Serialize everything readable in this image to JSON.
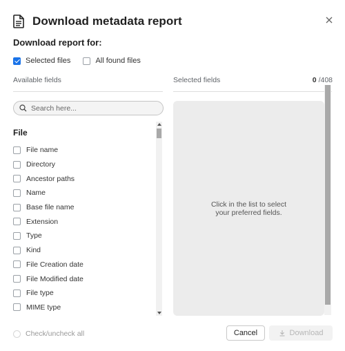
{
  "dialog": {
    "title": "Download metadata report",
    "close_icon": "close-icon",
    "title_icon": "document-icon"
  },
  "scope": {
    "heading": "Download report for:",
    "options": [
      {
        "label": "Selected files",
        "checked": true
      },
      {
        "label": "All found files",
        "checked": false
      }
    ]
  },
  "available": {
    "label": "Available fields",
    "search_placeholder": "Search here...",
    "group_title": "File",
    "fields": [
      "File name",
      "Directory",
      "Ancestor paths",
      "Name",
      "Base file name",
      "Extension",
      "Type",
      "Kind",
      "File Creation date",
      "File Modified date",
      "File type",
      "MIME type"
    ]
  },
  "selected": {
    "label": "Selected fields",
    "count": "0",
    "total": "/408",
    "empty_message": "Click in the list to select your preferred fields."
  },
  "footer": {
    "check_all_label": "Check/uncheck all",
    "cancel_label": "Cancel",
    "download_label": "Download"
  },
  "colors": {
    "accent": "#1a73e8",
    "panel_bg": "#ececec"
  }
}
